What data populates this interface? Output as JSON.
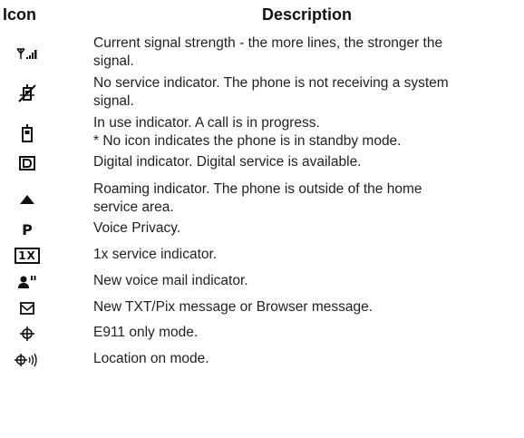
{
  "header": {
    "icon_label": "Icon",
    "description_label": "Description"
  },
  "rows": [
    {
      "icon": "signal-strength-icon",
      "lines": [
        "Current signal strength - the more lines, the stronger the",
        "signal."
      ]
    },
    {
      "icon": "no-service-icon",
      "lines": [
        "No service indicator. The phone is not receiving a system",
        "signal."
      ]
    },
    {
      "icon": "in-use-icon",
      "lines": [
        "In use indicator. A call is in progress.",
        "* No icon indicates the phone is in standby mode."
      ]
    },
    {
      "icon": "digital-icon",
      "lines": [
        "Digital indicator. Digital service is available."
      ]
    },
    {
      "icon": "roaming-icon",
      "lines": [
        "Roaming indicator. The phone is outside of the home",
        "service area."
      ]
    },
    {
      "icon": "voice-privacy-icon",
      "icon_text": "P",
      "lines": [
        "Voice Privacy."
      ]
    },
    {
      "icon": "1x-service-icon",
      "icon_text": "1X",
      "lines": [
        "1x service indicator."
      ]
    },
    {
      "icon": "voice-mail-icon",
      "lines": [
        "New voice mail indicator."
      ]
    },
    {
      "icon": "message-icon",
      "lines": [
        "New TXT/Pix message or Browser message."
      ]
    },
    {
      "icon": "e911-icon",
      "lines": [
        "E911 only mode."
      ]
    },
    {
      "icon": "location-on-icon",
      "lines": [
        "Location on mode."
      ]
    }
  ]
}
